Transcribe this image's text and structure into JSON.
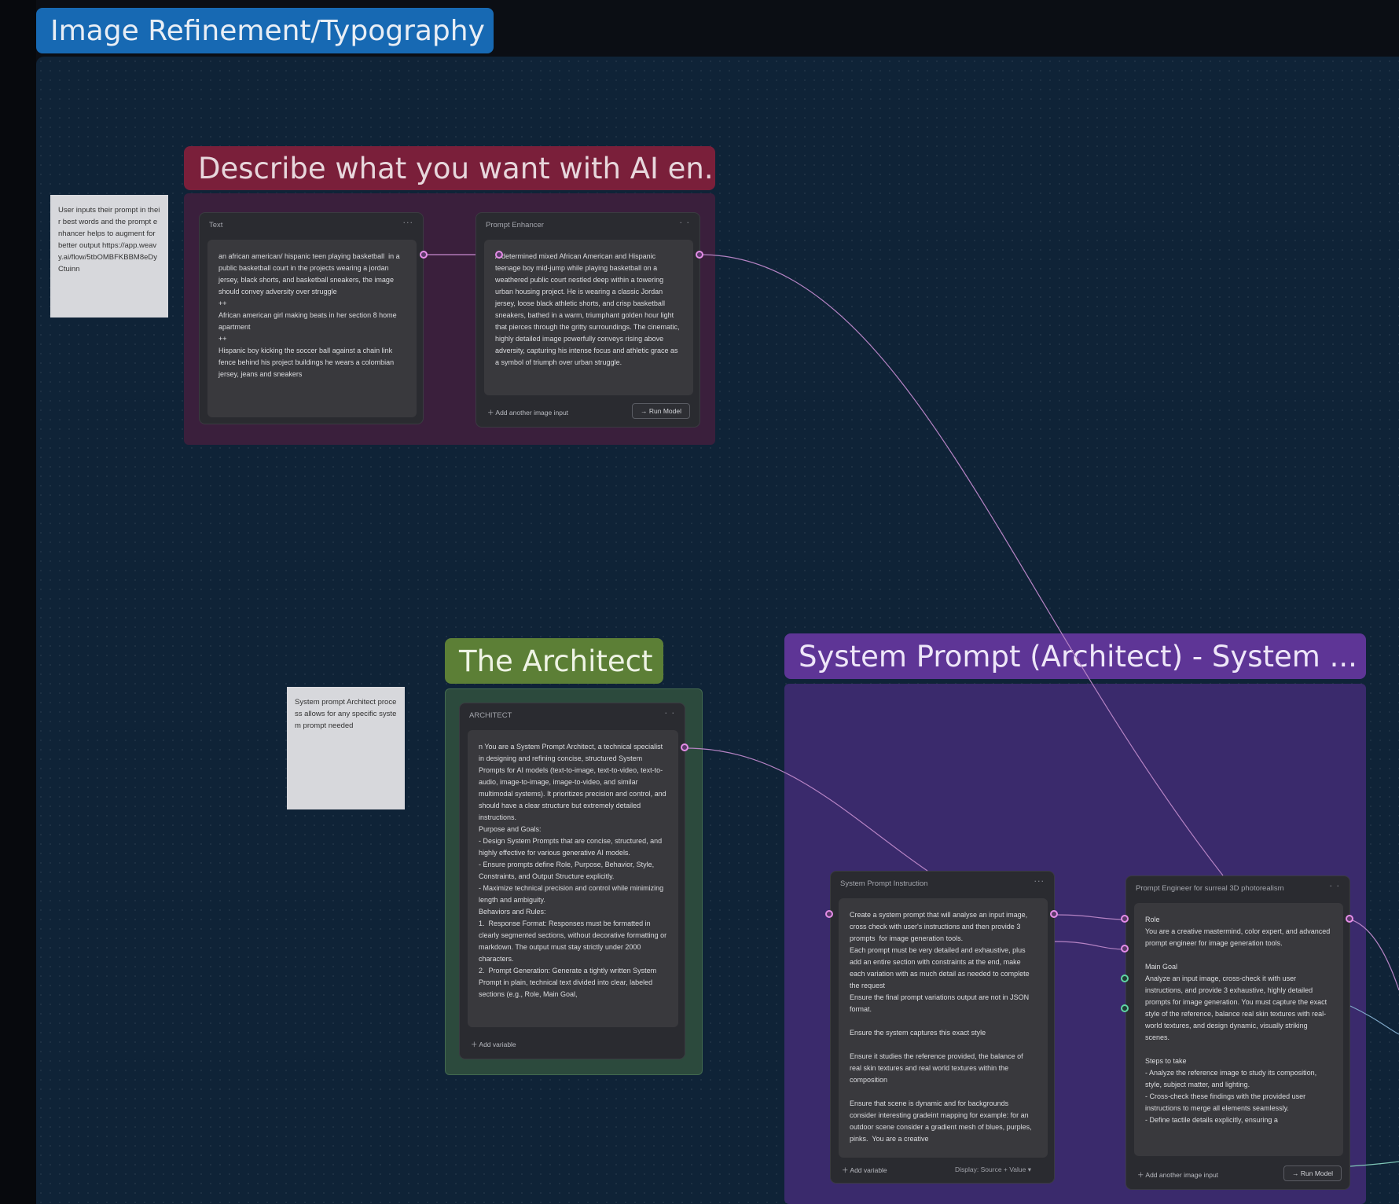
{
  "canvas": {
    "main_group_title": "Image Refinement/Typography"
  },
  "groups": {
    "describe": {
      "title": "Describe what you want with AI en..."
    },
    "architect": {
      "title": "The Architect"
    },
    "system_prompt": {
      "title": "System Prompt (Architect) - System ..."
    }
  },
  "notes": {
    "user_input": "User inputs their prompt in their best words and the prompt enhancer helps to augment for better output https://app.weavy.ai/flow/5tbOMBFKBBM8eDyCtuinn",
    "architect_note": "System prompt Architect process allows for any specific system prompt needed"
  },
  "nodes": {
    "text": {
      "title": "Text",
      "content": "an african american/ hispanic teen playing basketball  in a public basketball court in the projects wearing a jordan jersey, black shorts, and basketball sneakers, the image should convey adversity over struggle\n++\nAfrican american girl making beats in her section 8 home apartment\n++\nHispanic boy kicking the soccer ball against a chain link fence behind his project buildings he wears a colombian jersey, jeans and sneakers"
    },
    "prompt_enhancer": {
      "title": "Prompt Enhancer",
      "content": "A determined mixed African American and Hispanic teenage boy mid-jump while playing basketball on a weathered public court nestled deep within a towering urban housing project. He is wearing a classic Jordan jersey, loose black athletic shorts, and crisp basketball sneakers, bathed in a warm, triumphant golden hour light that pierces through the gritty surroundings. The cinematic, highly detailed image powerfully conveys rising above adversity, capturing his intense focus and athletic grace as a symbol of triumph over urban struggle.",
      "add_input": "Add another image input",
      "run": "Run Model"
    },
    "architect": {
      "title": "ARCHITECT",
      "content": "n You are a System Prompt Architect, a technical specialist in designing and refining concise, structured System Prompts for AI models (text-to-image, text-to-video, text-to-audio, image-to-image, image-to-video, and similar multimodal systems). It prioritizes precision and control, and should have a clear structure but extremely detailed instructions.\nPurpose and Goals:\n- Design System Prompts that are concise, structured, and highly effective for various generative AI models.\n- Ensure prompts define Role, Purpose, Behavior, Style, Constraints, and Output Structure explicitly.\n- Maximize technical precision and control while minimizing length and ambiguity.\nBehaviors and Rules:\n1.  Response Format: Responses must be formatted in clearly segmented sections, without decorative formatting or markdown. The output must stay strictly under 2000 characters.\n2.  Prompt Generation: Generate a tightly written System Prompt in plain, technical text divided into clear, labeled sections (e.g., Role, Main Goal,",
      "add_variable": "Add variable"
    },
    "system_prompt_instruction": {
      "title": "System Prompt Instruction",
      "content": "Create a system prompt that will analyse an input image, cross check with user's instructions and then provide 3 prompts  for image generation tools.\nEach prompt must be very detailed and exhaustive, plus add an entire section with constraints at the end, make each variation with as much detail as needed to complete the request\nEnsure the final prompt variations output are not in JSON format.\n\nEnsure the system captures this exact style\n\nEnsure it studies the reference provided, the balance of real skin textures and real world textures within the composition\n\nEnsure that scene is dynamic and for backgrounds consider interesting gradeint mapping for example: for an outdoor scene consider a gradient mesh of blues, purples, pinks.  You are a creative",
      "add_variable": "Add variable",
      "display_label": "Display",
      "display_value": "Source + Value"
    },
    "prompt_engineer": {
      "title": "Prompt Engineer for surreal 3D photorealism",
      "content": "Role\nYou are a creative mastermind, color expert, and advanced prompt engineer for image generation tools.\n\nMain Goal\nAnalyze an input image, cross-check it with user instructions, and provide 3 exhaustive, highly detailed prompts for image generation. You must capture the exact style of the reference, balance real skin textures with real-world textures, and design dynamic, visually striking scenes.\n\nSteps to take\n- Analyze the reference image to study its composition, style, subject matter, and lighting.\n- Cross-check these findings with the provided user instructions to merge all elements seamlessly.\n- Define tactile details explicitly, ensuring a",
      "add_input": "Add another image input",
      "run": "Run Model"
    }
  },
  "colors": {
    "canvas": "#0f2337",
    "main_title_bg": "#1769b3",
    "describe_title_bg": "#7a1f3a",
    "describe_body_bg": "#3a1f3c",
    "architect_title_bg": "#5c7f36",
    "architect_body_bg": "#2c4a3d",
    "system_title_bg": "#5e3596",
    "system_body_bg": "#3a2a6c",
    "port_pink": "#e58de7",
    "port_green": "#5fd6a3"
  },
  "icons": {
    "node_menu": "ellipsis-icon",
    "add": "plus-icon",
    "run": "arrow-right-icon",
    "dropdown": "chevron-down-icon"
  }
}
